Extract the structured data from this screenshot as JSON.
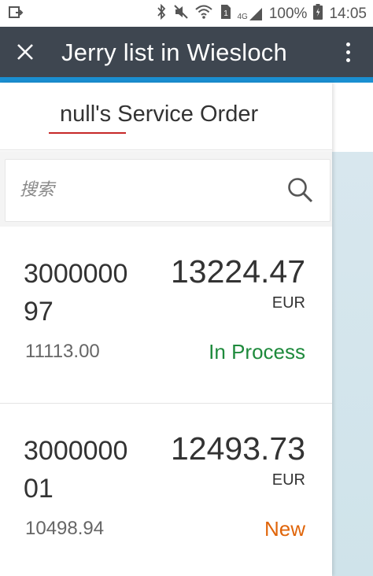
{
  "status_bar": {
    "battery": "100%",
    "time": "14:05",
    "network": "4G"
  },
  "app_bar": {
    "title": "Jerry list in Wiesloch"
  },
  "master": {
    "title": "null's Service Order",
    "search": {
      "placeholder": "搜索"
    },
    "orders": [
      {
        "number": "300000097",
        "amount": "13224.47",
        "currency": "EUR",
        "secondary": "11113.00",
        "status": "In Process",
        "status_color": "#1e8a3c"
      },
      {
        "number": "300000001",
        "amount": "12493.73",
        "currency": "EUR",
        "secondary": "10498.94",
        "status": "New",
        "status_color": "#e0650a"
      }
    ]
  },
  "colors": {
    "app_bar": "#3e4650",
    "accent": "#1a8fd1",
    "title_underline": "#c62828"
  }
}
